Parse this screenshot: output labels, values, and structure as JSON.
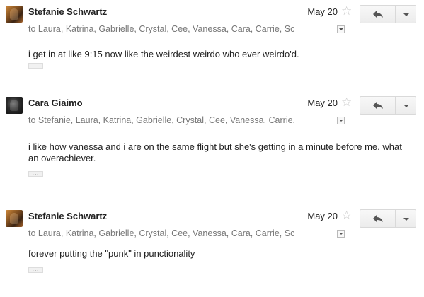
{
  "messages": [
    {
      "sender": "Stefanie Schwartz",
      "date": "May 20",
      "recipients": "to Laura, Katrina, Gabrielle, Crystal, Cee, Vanessa, Cara, Carrie, Sc",
      "body": "i get in at like 9:15 now like the weirdest weirdo who ever weirdo'd.",
      "quoted_toggle": "..."
    },
    {
      "sender": "Cara Giaimo",
      "date": "May 20",
      "recipients": "to Stefanie, Laura, Katrina, Gabrielle, Crystal, Cee, Vanessa, Carrie,",
      "body": "i like how vanessa and i are on the same flight but she's getting in a minute before me. what an overachiever.",
      "quoted_toggle": "..."
    },
    {
      "sender": "Stefanie Schwartz",
      "date": "May 20",
      "recipients": "to Laura, Katrina, Gabrielle, Crystal, Cee, Vanessa, Cara, Carrie, Sc",
      "body": "forever putting the \"punk\" in punctionality",
      "quoted_toggle": "..."
    }
  ],
  "icons": {
    "star": "star-icon",
    "reply": "reply-icon",
    "more": "chevron-down-icon",
    "recipients": "chevron-down-icon"
  },
  "colors": {
    "text": "#222222",
    "muted": "#777777",
    "border": "#d9d9d9",
    "star": "#c8c8c8"
  }
}
